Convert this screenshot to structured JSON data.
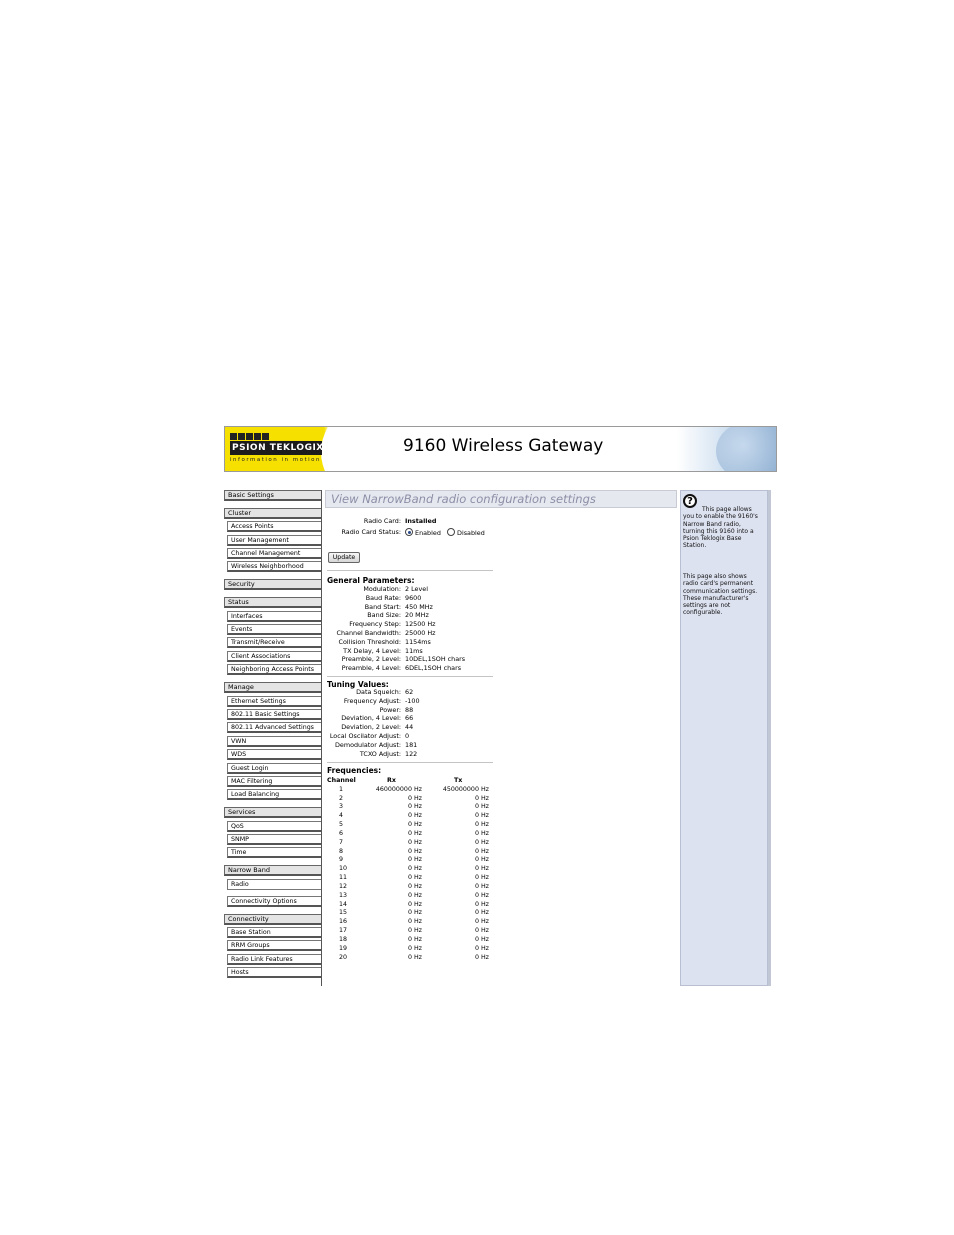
{
  "header": {
    "logo_word": "PSION TEKLOGIX",
    "logo_tagline": "information in motion",
    "app_title": "9160 Wireless Gateway"
  },
  "sidebar": {
    "groups": [
      {
        "label": "Basic Settings",
        "items": []
      },
      {
        "label": "Cluster",
        "items": [
          "Access Points",
          "User Management",
          "Channel Management",
          "Wireless Neighborhood"
        ]
      },
      {
        "label": "Security",
        "items": []
      },
      {
        "label": "Status",
        "items": [
          "Interfaces",
          "Events",
          "Transmit/Receive",
          "Client Associations",
          "Neighboring Access Points"
        ]
      },
      {
        "label": "Manage",
        "items": [
          "Ethernet Settings",
          "802.11 Basic Settings",
          "802.11 Advanced Settings",
          "VWN",
          "WDS",
          "Guest Login",
          "MAC Filtering",
          "Load Balancing"
        ]
      },
      {
        "label": "Services",
        "items": [
          "QoS",
          "SNMP",
          "Time"
        ]
      },
      {
        "label": "Narrow Band",
        "items": [
          "Radio",
          "Connectivity Options"
        ]
      },
      {
        "label": "Connectivity",
        "items": [
          "Base Station",
          "RRM Groups",
          "Radio Link Features",
          "Hosts"
        ]
      }
    ],
    "active_item": "Radio"
  },
  "main": {
    "page_heading": "View NarrowBand radio configuration settings",
    "radio_card_label": "Radio Card:",
    "radio_card_value": "Installed",
    "radio_status_label": "Radio Card Status:",
    "radio_status_options": [
      "Enabled",
      "Disabled"
    ],
    "radio_status_selected": "Enabled",
    "update_button": "Update",
    "general_heading": "General Parameters:",
    "general": [
      {
        "label": "Modulation:",
        "value": "2 Level"
      },
      {
        "label": "Baud Rate:",
        "value": "9600"
      },
      {
        "label": "Band Start:",
        "value": "450 MHz"
      },
      {
        "label": "Band Size:",
        "value": "20 MHz"
      },
      {
        "label": "Frequency Step:",
        "value": "12500 Hz"
      },
      {
        "label": "Channel Bandwidth:",
        "value": "25000 Hz"
      },
      {
        "label": "Collision Threshold:",
        "value": "1154ms"
      },
      {
        "label": "TX Delay, 4 Level:",
        "value": "11ms"
      },
      {
        "label": "Preamble, 2 Level:",
        "value": "10DEL,1SOH chars"
      },
      {
        "label": "Preamble, 4 Level:",
        "value": "6DEL,1SOH chars"
      }
    ],
    "tuning_heading": "Tuning Values:",
    "tuning": [
      {
        "label": "Data Squelch:",
        "value": "62"
      },
      {
        "label": "Frequency Adjust:",
        "value": "-100"
      },
      {
        "label": "Power:",
        "value": "88"
      },
      {
        "label": "Deviation, 4 Level:",
        "value": "66"
      },
      {
        "label": "Deviation, 2 Level:",
        "value": "44"
      },
      {
        "label": "Local Oscilator Adjust:",
        "value": "0"
      },
      {
        "label": "Demodulator Adjust:",
        "value": "181"
      },
      {
        "label": "TCXO Adjust:",
        "value": "122"
      }
    ],
    "freq_heading": "Frequencies:",
    "freq_columns": [
      "Channel",
      "Rx",
      "Tx"
    ],
    "frequencies": [
      [
        "1",
        "460000000 Hz",
        "450000000 Hz"
      ],
      [
        "2",
        "0 Hz",
        "0 Hz"
      ],
      [
        "3",
        "0 Hz",
        "0 Hz"
      ],
      [
        "4",
        "0 Hz",
        "0 Hz"
      ],
      [
        "5",
        "0 Hz",
        "0 Hz"
      ],
      [
        "6",
        "0 Hz",
        "0 Hz"
      ],
      [
        "7",
        "0 Hz",
        "0 Hz"
      ],
      [
        "8",
        "0 Hz",
        "0 Hz"
      ],
      [
        "9",
        "0 Hz",
        "0 Hz"
      ],
      [
        "10",
        "0 Hz",
        "0 Hz"
      ],
      [
        "11",
        "0 Hz",
        "0 Hz"
      ],
      [
        "12",
        "0 Hz",
        "0 Hz"
      ],
      [
        "13",
        "0 Hz",
        "0 Hz"
      ],
      [
        "14",
        "0 Hz",
        "0 Hz"
      ],
      [
        "15",
        "0 Hz",
        "0 Hz"
      ],
      [
        "16",
        "0 Hz",
        "0 Hz"
      ],
      [
        "17",
        "0 Hz",
        "0 Hz"
      ],
      [
        "18",
        "0 Hz",
        "0 Hz"
      ],
      [
        "19",
        "0 Hz",
        "0 Hz"
      ],
      [
        "20",
        "0 Hz",
        "0 Hz"
      ]
    ]
  },
  "help": {
    "icon": "question-icon",
    "paragraph1": "This page allows you to enable the 9160's Narrow Band radio, turning this 9160 into a Psion Teklogix Base Station.",
    "paragraph2": "This page also shows radio card's permanent communication settings. These manufacturer's settings are not configurable."
  },
  "colors": {
    "banner_yellow": "#f6e000",
    "heading_text": "#8c8fa6",
    "help_panel": "#dde2f0"
  }
}
